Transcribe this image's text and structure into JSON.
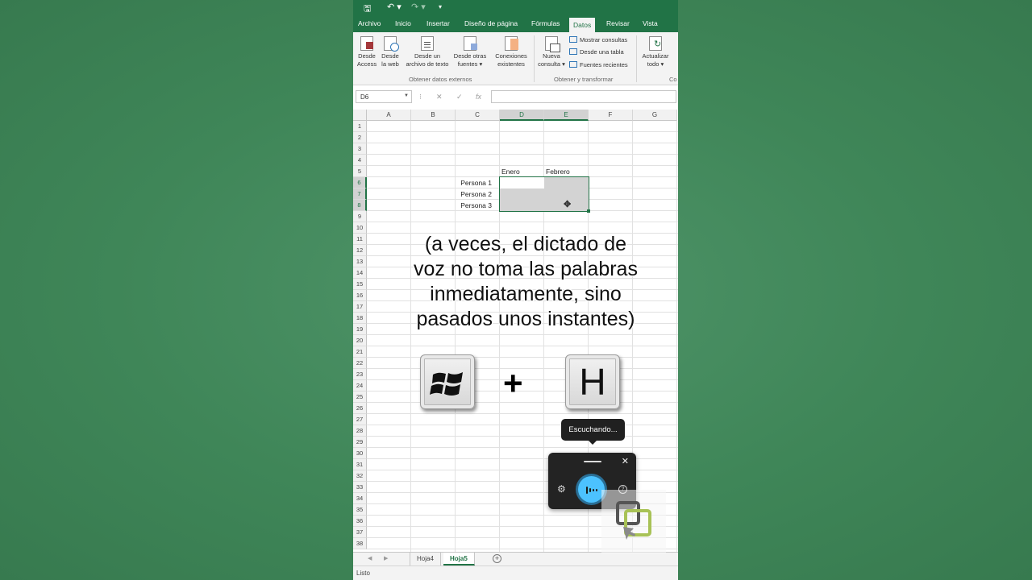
{
  "ribbon": {
    "tabs": [
      "Archivo",
      "Inicio",
      "Insertar",
      "Diseño de página",
      "Fórmulas",
      "Datos",
      "Revisar",
      "Vista"
    ],
    "active_tab": "Datos",
    "buttons": {
      "access": [
        "Desde",
        "Access"
      ],
      "web": [
        "Desde",
        "la web"
      ],
      "text": [
        "Desde un",
        "archivo de texto"
      ],
      "other": [
        "Desde otras",
        "fuentes ▾"
      ],
      "conn": [
        "Conexiones",
        "existentes"
      ],
      "query": [
        "Nueva",
        "consulta ▾"
      ],
      "refresh": [
        "Actualizar",
        "todo ▾"
      ]
    },
    "small_buttons": [
      "Mostrar consultas",
      "Desde una tabla",
      "Fuentes recientes"
    ],
    "groups": [
      "Obtener datos externos",
      "Obtener y transformar",
      "Co"
    ]
  },
  "formula_bar": {
    "name_box": "D6",
    "cancel_symbol": "✕",
    "enter_symbol": "✓",
    "fx_symbol": "fx",
    "options_symbol": "⁝"
  },
  "grid": {
    "columns": [
      "A",
      "B",
      "C",
      "D",
      "E",
      "F",
      "G"
    ],
    "rows": [
      "1",
      "2",
      "3",
      "4",
      "5",
      "6",
      "7",
      "8",
      "9",
      "10",
      "11",
      "12",
      "13",
      "14",
      "15",
      "16",
      "17",
      "18",
      "19",
      "20",
      "21",
      "22",
      "23",
      "24",
      "25",
      "26",
      "27",
      "28",
      "29",
      "30",
      "31",
      "32",
      "33",
      "34",
      "35",
      "36",
      "37",
      "38"
    ],
    "headers": {
      "d5": "Enero",
      "e5": "Febrero"
    },
    "labels": {
      "c6": "Persona 1",
      "c7": "Persona 2",
      "c8": "Persona 3"
    }
  },
  "sheets": {
    "tabs": [
      "Hoja4",
      "Hoja5"
    ],
    "active": "Hoja5",
    "add": "+"
  },
  "status": "Listo",
  "overlay": {
    "caption_lines": [
      "(a veces, el dictado de",
      "voz no toma las palabras",
      "inmediatamente, sino",
      "pasados unos instantes)"
    ],
    "key_letter": "H",
    "plus": "+"
  },
  "dictation": {
    "tooltip": "Escuchando...",
    "close": "✕",
    "help": "?"
  },
  "colors": {
    "excel_green": "#217346",
    "mic_blue": "#4cc2ff",
    "background_green": "#3f8658"
  },
  "icons": [
    "save-icon",
    "undo-icon",
    "redo-icon",
    "gear-icon",
    "microphone-icon",
    "help-icon",
    "close-icon",
    "windows-logo-icon"
  ]
}
